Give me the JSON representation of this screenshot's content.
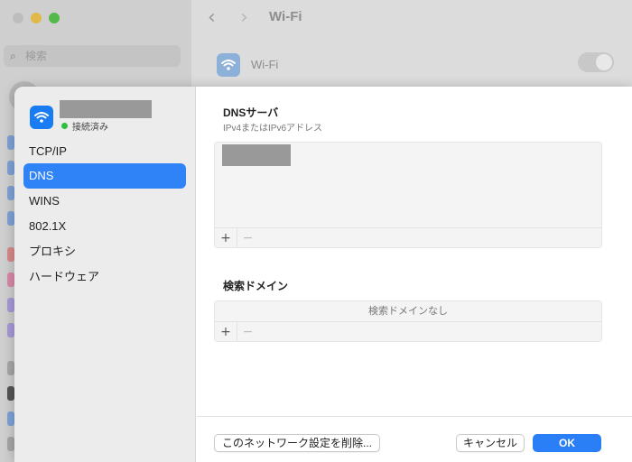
{
  "background": {
    "search_placeholder": "検索",
    "title": "Wi-Fi",
    "wifi_label": "Wi-Fi"
  },
  "sheet": {
    "status": "接続済み",
    "sidebar_items": [
      {
        "label": "TCP/IP",
        "selected": false
      },
      {
        "label": "DNS",
        "selected": true
      },
      {
        "label": "WINS",
        "selected": false
      },
      {
        "label": "802.1X",
        "selected": false
      },
      {
        "label": "プロキシ",
        "selected": false
      },
      {
        "label": "ハードウェア",
        "selected": false
      }
    ],
    "dns": {
      "title": "DNSサーバ",
      "subtitle": "IPv4またはIPv6アドレス",
      "add": "+",
      "remove": "−"
    },
    "search_domains": {
      "title": "検索ドメイン",
      "empty": "検索ドメインなし",
      "add": "+",
      "remove": "−"
    },
    "footer": {
      "delete_label": "このネットワーク設定を削除...",
      "cancel_label": "キャンセル",
      "ok_label": "OK"
    }
  },
  "colors": {
    "accent": "#2f83f7",
    "connected": "#2dbf3d"
  }
}
